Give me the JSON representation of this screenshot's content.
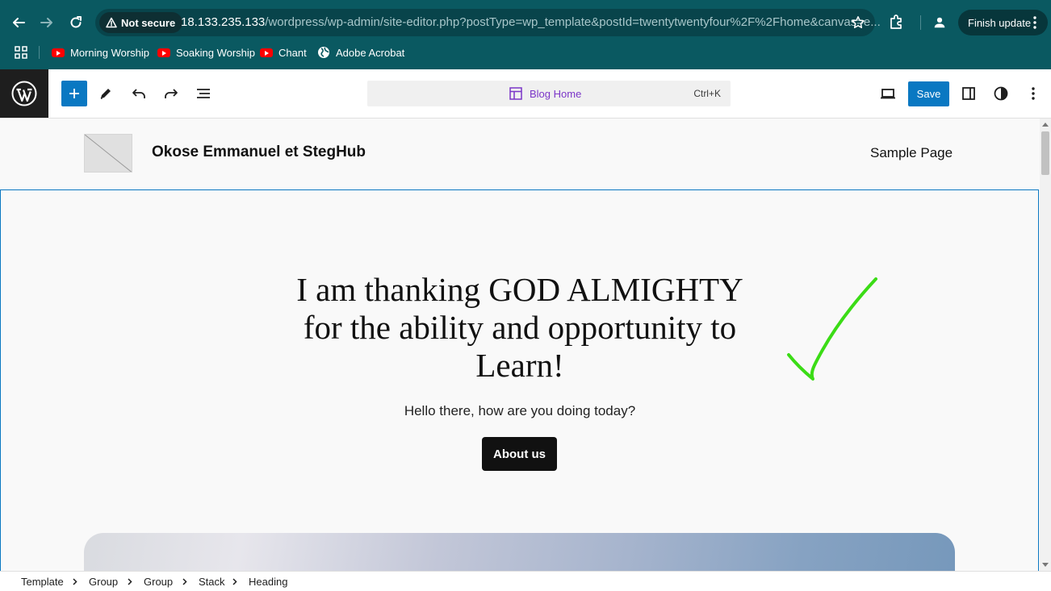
{
  "browser": {
    "security_label": "Not secure",
    "url_host": "18.133.235.133",
    "url_rest": "/wordpress/wp-admin/site-editor.php?postType=wp_template&postId=twentytwentyfour%2F%2Fhome&canvas=e...",
    "finish_update_label": "Finish update",
    "theme_color": "#0a5961"
  },
  "bookmarks": [
    {
      "label": "Morning Worship",
      "icon": "youtube-icon"
    },
    {
      "label": "Soaking Worship",
      "icon": "youtube-icon"
    },
    {
      "label": "Chant",
      "icon": "youtube-icon"
    },
    {
      "label": "Adobe Acrobat",
      "icon": "globe-icon"
    }
  ],
  "editor": {
    "document_title": "Blog Home",
    "shortcut": "Ctrl+K",
    "save_label": "Save",
    "accent_color": "#0a78c2"
  },
  "site": {
    "title": "Okose Emmanuel et StegHub",
    "nav_item": "Sample Page",
    "hero_heading": "I am thanking GOD ALMIGHTY for the ability and opportunity to Learn!",
    "hero_subtitle": "Hello there, how are you doing today?",
    "cta_label": "About us"
  },
  "breadcrumbs": [
    "Template",
    "Group",
    "Group",
    "Stack",
    "Heading"
  ]
}
